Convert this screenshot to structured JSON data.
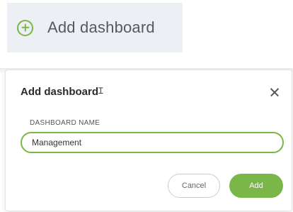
{
  "add_button": {
    "label": "Add dashboard",
    "icon": "plus-circle-icon"
  },
  "dialog": {
    "title": "Add dashboard",
    "close_icon": "close-icon",
    "field_label": "DASHBOARD NAME",
    "name_value": "Management",
    "cancel_label": "Cancel",
    "add_label": "Add"
  },
  "colors": {
    "accent": "#7ab648",
    "button_bg": "#eceff3",
    "text": "#2b2b2b"
  }
}
